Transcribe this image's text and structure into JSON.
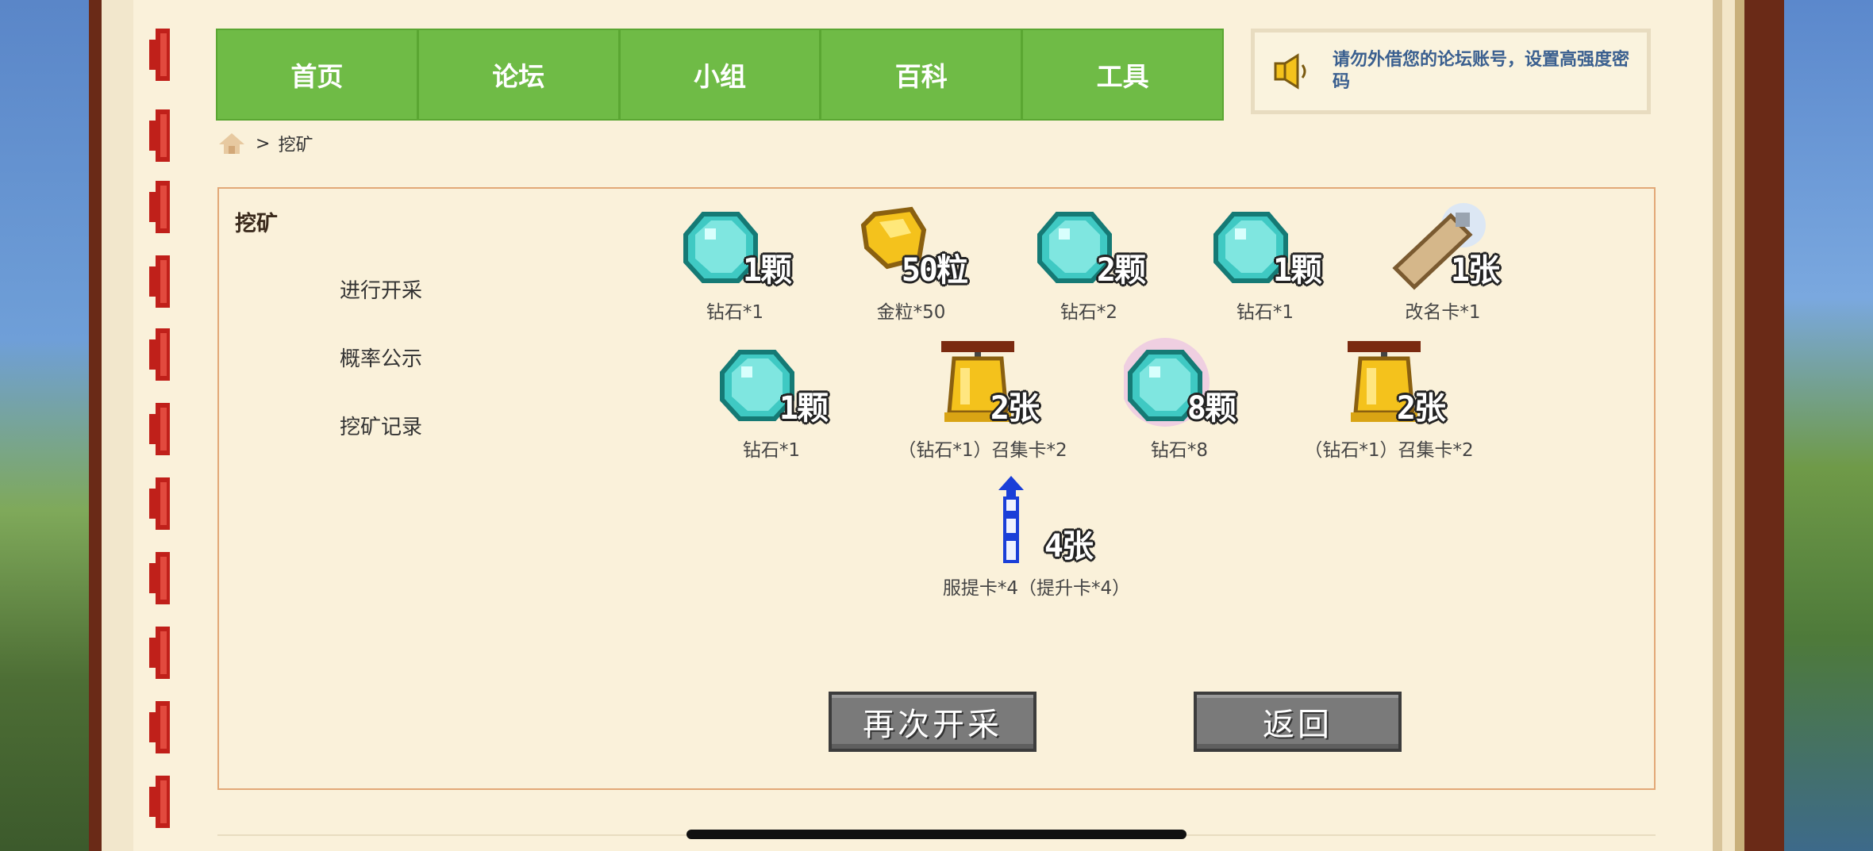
{
  "nav": {
    "items": [
      "首页",
      "论坛",
      "小组",
      "百科",
      "工具"
    ]
  },
  "notice": {
    "text": "请勿外借您的论坛账号，设置高强度密码"
  },
  "breadcrumb": {
    "separator": ">",
    "current": "挖矿"
  },
  "panel": {
    "title": "挖矿",
    "links": [
      "进行开采",
      "概率公示",
      "挖矿记录"
    ]
  },
  "rewards": [
    {
      "icon": "diamond-icon",
      "qty": "1颗",
      "caption": "钻石*1"
    },
    {
      "icon": "gold-nugget-icon",
      "qty": "50粒",
      "caption": "金粒*50"
    },
    {
      "icon": "diamond-icon",
      "qty": "2颗",
      "caption": "钻石*2"
    },
    {
      "icon": "diamond-icon",
      "qty": "1颗",
      "caption": "钻石*1"
    },
    {
      "icon": "rename-card-icon",
      "qty": "1张",
      "caption": "改名卡*1"
    },
    {
      "icon": "diamond-icon",
      "qty": "1颗",
      "caption": "钻石*1"
    },
    {
      "icon": "bell-icon",
      "qty": "2张",
      "caption": "（钻石*1）召集卡*2"
    },
    {
      "icon": "diamond-glow-icon",
      "qty": "8颗",
      "caption": "钻石*8"
    },
    {
      "icon": "bell-icon",
      "qty": "2张",
      "caption": "（钻石*1）召集卡*2"
    },
    {
      "icon": "firework-icon",
      "qty": "4张",
      "caption": "服提卡*4（提升卡*4）"
    }
  ],
  "buttons": {
    "again": "再次开采",
    "back": "返回"
  },
  "colors": {
    "nav_green": "#6fbb46",
    "notice_text": "#3a5f8f",
    "frame_brown": "#6a2a17",
    "box_border": "#e2a877"
  }
}
